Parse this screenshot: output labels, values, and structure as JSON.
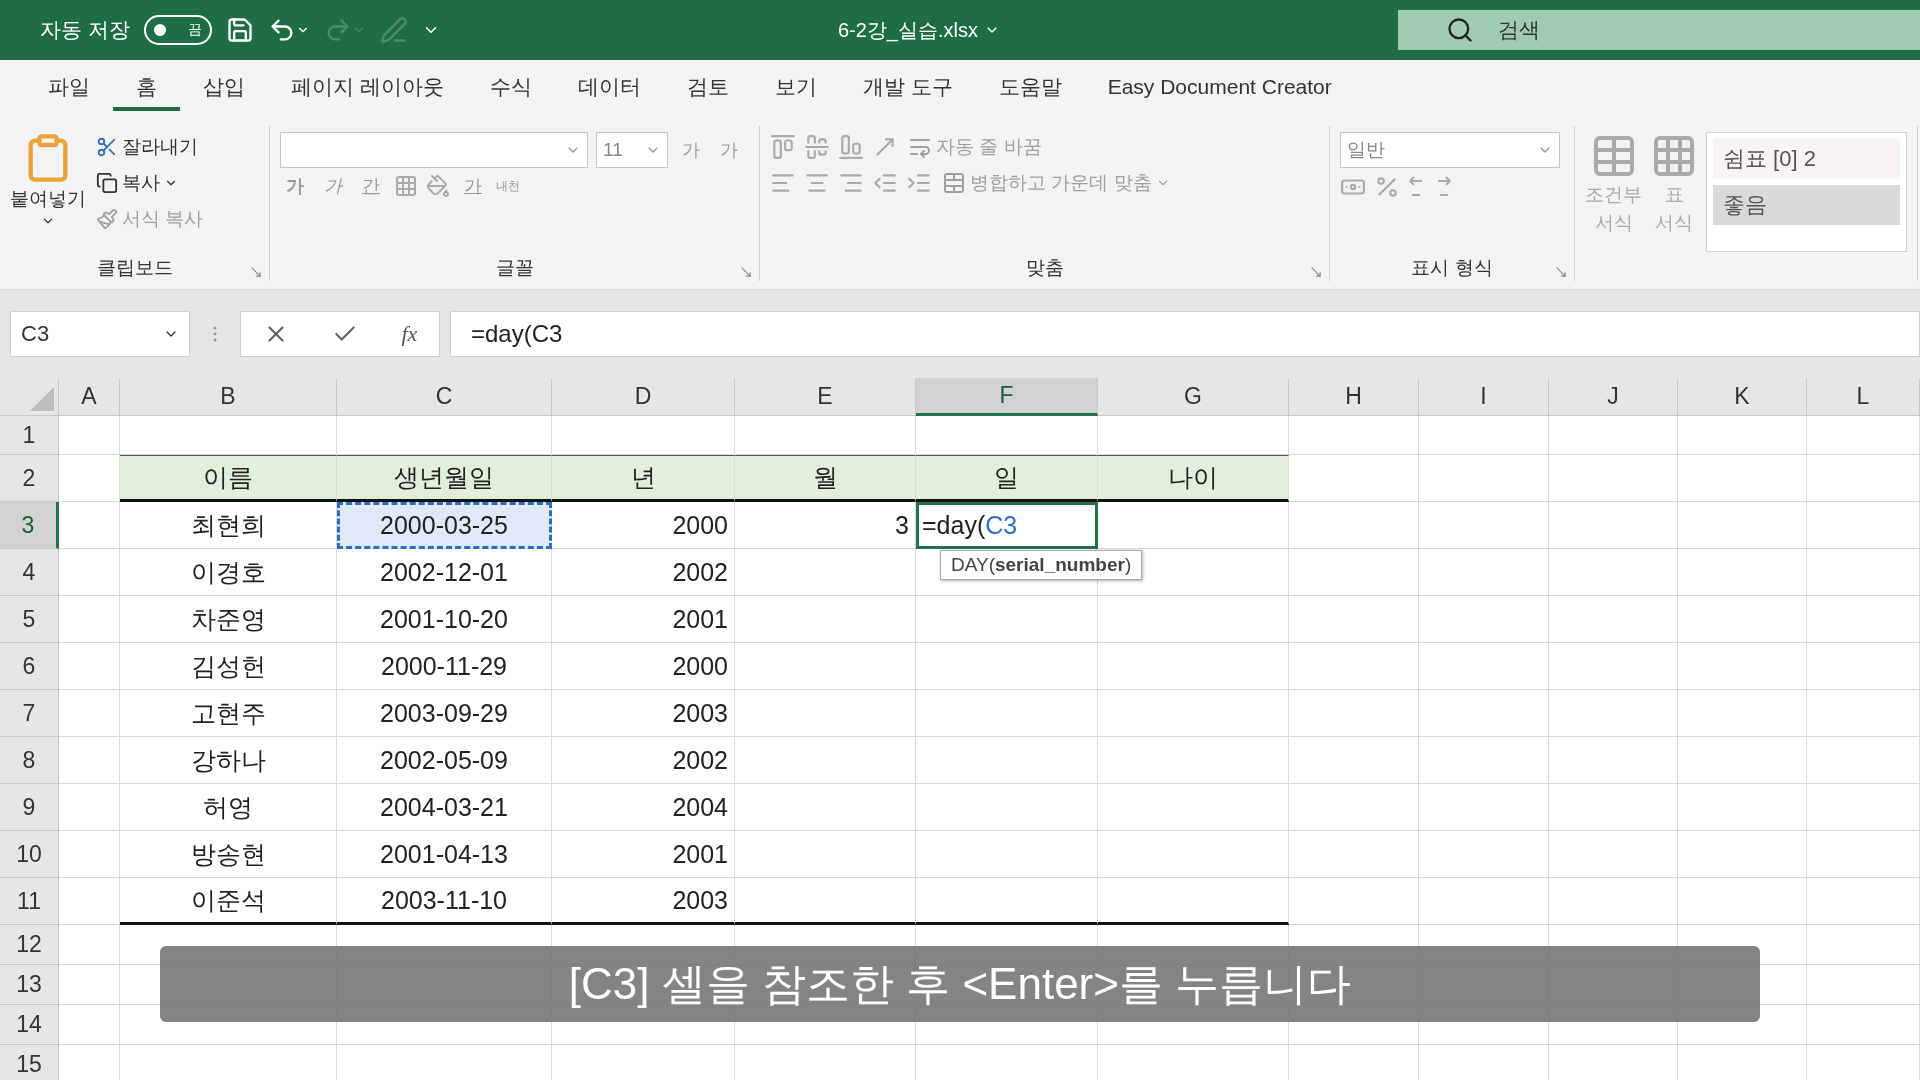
{
  "title_bar": {
    "autosave_label": "자동 저장",
    "autosave_toggle": {
      "label": "끔",
      "on": false
    },
    "filename": "6-2강_실습.xlsx",
    "search": {
      "placeholder": "검색"
    }
  },
  "menu_tabs": [
    {
      "label": "파일",
      "selected": false
    },
    {
      "label": "홈",
      "selected": true
    },
    {
      "label": "삽입",
      "selected": false
    },
    {
      "label": "페이지 레이아웃",
      "selected": false
    },
    {
      "label": "수식",
      "selected": false
    },
    {
      "label": "데이터",
      "selected": false
    },
    {
      "label": "검토",
      "selected": false
    },
    {
      "label": "보기",
      "selected": false
    },
    {
      "label": "개발 도구",
      "selected": false
    },
    {
      "label": "도움말",
      "selected": false
    },
    {
      "label": "Easy Document Creator",
      "selected": false
    }
  ],
  "ribbon": {
    "clipboard": {
      "paste": "붙여넣기",
      "cut": "잘라내기",
      "copy": "복사",
      "format_painter": "서식 복사",
      "label": "클립보드"
    },
    "font": {
      "size": "11",
      "grow": "가",
      "shrink": "가",
      "buttons": [
        {
          "kind": "bold",
          "label": "가"
        },
        {
          "kind": "italic",
          "label": "가"
        },
        {
          "kind": "underline",
          "label": "간"
        }
      ],
      "font_color": "가",
      "phonetic": "내천",
      "label": "글꼴"
    },
    "alignment": {
      "wrap": "자동 줄 바꿈",
      "merge": "병합하고 가운데 맞춤",
      "label": "맞춤"
    },
    "number": {
      "format": "일반",
      "label": "표시 형식"
    },
    "styles": {
      "conditional": [
        "조건부",
        "서식"
      ],
      "table": [
        "표",
        "서식"
      ],
      "cell_styles": [
        {
          "label": "쉼표 [0] 2",
          "selected": false
        },
        {
          "label": "좋음",
          "selected": true
        }
      ]
    }
  },
  "formula_bar": {
    "name_box": "C3",
    "fx": "fx",
    "formula": "=day(C3"
  },
  "sheet": {
    "columns": [
      {
        "label": "A",
        "selected": false
      },
      {
        "label": "B",
        "selected": false
      },
      {
        "label": "C",
        "selected": false
      },
      {
        "label": "D",
        "selected": false
      },
      {
        "label": "E",
        "selected": false
      },
      {
        "label": "F",
        "selected": true
      },
      {
        "label": "G",
        "selected": false
      },
      {
        "label": "H",
        "selected": false
      },
      {
        "label": "I",
        "selected": false
      },
      {
        "label": "J",
        "selected": false
      },
      {
        "label": "K",
        "selected": false
      },
      {
        "label": "L",
        "selected": false
      }
    ],
    "rows": [
      {
        "number": "1",
        "selected": false,
        "kind": "empty"
      },
      {
        "number": "2",
        "selected": false,
        "kind": "header",
        "cells": [
          {
            "text": "이름",
            "referenced": false
          },
          {
            "text": "생년월일",
            "referenced": false
          },
          {
            "text": "년",
            "referenced": false
          },
          {
            "text": "월",
            "referenced": false
          },
          {
            "text": "일",
            "referenced": false
          },
          {
            "text": "나이",
            "referenced": false
          }
        ]
      },
      {
        "number": "3",
        "selected": true,
        "kind": "data",
        "cells": [
          {
            "text": "최현희",
            "referenced": false
          },
          {
            "text": "2000-03-25",
            "referenced": true
          },
          {
            "text": "2000",
            "referenced": false
          },
          {
            "text": "3",
            "referenced": false
          }
        ],
        "editing": {
          "prefix": "=day(",
          "reference": "C3",
          "tooltip": "DAY(**serial_number**)"
        }
      },
      {
        "number": "4",
        "selected": false,
        "kind": "data",
        "cells": [
          {
            "text": "이경호",
            "referenced": false
          },
          {
            "text": "2002-12-01",
            "referenced": false
          },
          {
            "text": "2002",
            "referenced": false
          }
        ]
      },
      {
        "number": "5",
        "selected": false,
        "kind": "data",
        "cells": [
          {
            "text": "차준영",
            "referenced": false
          },
          {
            "text": "2001-10-20",
            "referenced": false
          },
          {
            "text": "2001",
            "referenced": false
          }
        ]
      },
      {
        "number": "6",
        "selected": false,
        "kind": "data",
        "cells": [
          {
            "text": "김성헌",
            "referenced": false
          },
          {
            "text": "2000-11-29",
            "referenced": false
          },
          {
            "text": "2000",
            "referenced": false
          }
        ]
      },
      {
        "number": "7",
        "selected": false,
        "kind": "data",
        "cells": [
          {
            "text": "고현주",
            "referenced": false
          },
          {
            "text": "2003-09-29",
            "referenced": false
          },
          {
            "text": "2003",
            "referenced": false
          }
        ]
      },
      {
        "number": "8",
        "selected": false,
        "kind": "data",
        "cells": [
          {
            "text": "강하나",
            "referenced": false
          },
          {
            "text": "2002-05-09",
            "referenced": false
          },
          {
            "text": "2002",
            "referenced": false
          }
        ]
      },
      {
        "number": "9",
        "selected": false,
        "kind": "data",
        "cells": [
          {
            "text": "허영",
            "referenced": false
          },
          {
            "text": "2004-03-21",
            "referenced": false
          },
          {
            "text": "2004",
            "referenced": false
          }
        ]
      },
      {
        "number": "10",
        "selected": false,
        "kind": "data",
        "cells": [
          {
            "text": "방송현",
            "referenced": false
          },
          {
            "text": "2001-04-13",
            "referenced": false
          },
          {
            "text": "2001",
            "referenced": false
          }
        ]
      },
      {
        "number": "11",
        "selected": false,
        "kind": "data",
        "cells": [
          {
            "text": "이준석",
            "referenced": false
          },
          {
            "text": "2003-11-10",
            "referenced": false
          },
          {
            "text": "2003",
            "referenced": false
          }
        ]
      },
      {
        "number": "12",
        "selected": false,
        "kind": "empty"
      },
      {
        "number": "13",
        "selected": false,
        "kind": "empty"
      },
      {
        "number": "14",
        "selected": false,
        "kind": "empty"
      },
      {
        "number": "15",
        "selected": false,
        "kind": "empty"
      }
    ]
  },
  "subtitle": "[C3] 셀을 참조한 후 <Enter>를 누릅니다"
}
